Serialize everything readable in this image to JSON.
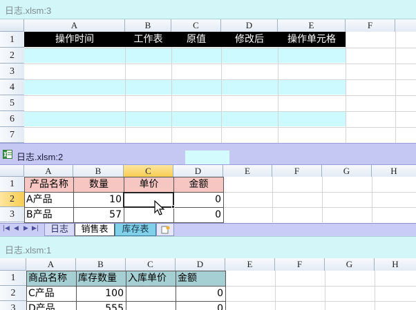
{
  "windows": {
    "w3": {
      "title": "日志.xlsm:3",
      "columns": [
        "A",
        "B",
        "C",
        "D",
        "E",
        "F"
      ],
      "rows": [
        "1",
        "2",
        "3",
        "4",
        "5",
        "6",
        "7"
      ],
      "header_cells": [
        "操作时间",
        "工作表",
        "原值",
        "修改后",
        "操作单元格"
      ]
    },
    "w2": {
      "title": "日志.xlsm:2",
      "columns": [
        "A",
        "B",
        "C",
        "D",
        "E",
        "F",
        "G",
        "H"
      ],
      "rows": [
        "1",
        "2",
        "3"
      ],
      "table": {
        "headers": [
          "产品名称",
          "数量",
          "单价",
          "金额"
        ],
        "rows": [
          [
            "A产品",
            "10",
            "",
            "0"
          ],
          [
            "B产品",
            "57",
            "",
            "0"
          ]
        ]
      },
      "sheet_tabs": [
        "日志",
        "销售表",
        "库存表"
      ]
    },
    "w1": {
      "title": "日志.xlsm:1",
      "columns": [
        "A",
        "B",
        "C",
        "D",
        "E",
        "F",
        "G",
        "H"
      ],
      "rows": [
        "1",
        "2",
        "3"
      ],
      "table": {
        "headers": [
          "商品名称",
          "库存数量",
          "入库单价",
          "金额"
        ],
        "rows": [
          [
            "C产品",
            "100",
            "",
            "0"
          ],
          [
            "D产品",
            "555",
            "",
            "0"
          ]
        ]
      }
    }
  },
  "colors": {
    "inactive_title": "#d3f6f8",
    "active_title": "#c6c8f4",
    "log_band": "#ccfafe",
    "header_black": "#000000",
    "salmon_header": "#f6c6c2",
    "teal_header": "#a5cfd2",
    "selected_col": "#f8cc50"
  }
}
